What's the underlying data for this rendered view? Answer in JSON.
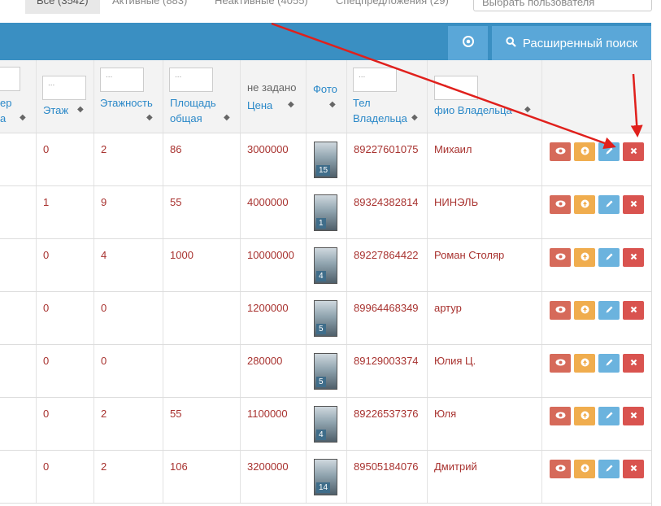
{
  "tabs": [
    {
      "label": "Все (3542)",
      "active": true
    },
    {
      "label": "Активные (883)",
      "active": false
    },
    {
      "label": "Неактивные (4055)",
      "active": false
    },
    {
      "label": "Спецпредложения (29)",
      "active": false
    }
  ],
  "user_select": {
    "placeholder": "Выбрать пользователя"
  },
  "toolbar": {
    "settings_icon": "settings-icon",
    "advanced_search_label": "Расширенный поиск",
    "search_icon": "search-icon"
  },
  "table": {
    "headers": {
      "number_fragment_1": "ер",
      "number_fragment_2": "а",
      "floor": "Этаж",
      "floors_total": "Этажность",
      "area_line1": "Площадь",
      "area_line2": "общая",
      "price_above": "не задано",
      "price": "Цена",
      "photo": "Фото",
      "phone_line1": "Тел",
      "phone_line2": "Владельца",
      "owner_name": "фио Владельца"
    },
    "filter_placeholder": "...",
    "rows": [
      {
        "floor": "0",
        "floors": "2",
        "area": "86",
        "price": "3000000",
        "photos": "15",
        "phone": "89227601075",
        "owner": "Михаил"
      },
      {
        "floor": "1",
        "floors": "9",
        "area": "55",
        "price": "4000000",
        "photos": "1",
        "phone": "89324382814",
        "owner": "НИНЭЛЬ"
      },
      {
        "floor": "0",
        "floors": "4",
        "area": "1000",
        "price": "10000000",
        "photos": "4",
        "phone": "89227864422",
        "owner": "Роман Столяр"
      },
      {
        "floor": "0",
        "floors": "0",
        "area": "",
        "price": "1200000",
        "photos": "5",
        "phone": "89964468349",
        "owner": "артур"
      },
      {
        "floor": "0",
        "floors": "0",
        "area": "",
        "price": "280000",
        "photos": "5",
        "phone": "89129003374",
        "owner": "Юлия Ц."
      },
      {
        "floor": "0",
        "floors": "2",
        "area": "55",
        "price": "1100000",
        "photos": "4",
        "phone": "89226537376",
        "owner": "Юля"
      },
      {
        "floor": "0",
        "floors": "2",
        "area": "106",
        "price": "3200000",
        "photos": "14",
        "phone": "89505184076",
        "owner": "Дмитрий"
      }
    ],
    "actions": {
      "view_icon": "eye-icon",
      "up_icon": "arrow-up-icon",
      "edit_icon": "pencil-icon",
      "delete_icon": "close-icon"
    }
  },
  "colors": {
    "toolbar": "#3a8fc2",
    "toolbar_button": "#5aa7d8",
    "header_link": "#2a88c8",
    "value_text": "#a8322f",
    "view_button": "#d66a5a",
    "up_button": "#f0ad4e",
    "edit_button": "#6bb3de",
    "delete_button": "#d9534f",
    "annotation_arrow": "#e0201c"
  }
}
